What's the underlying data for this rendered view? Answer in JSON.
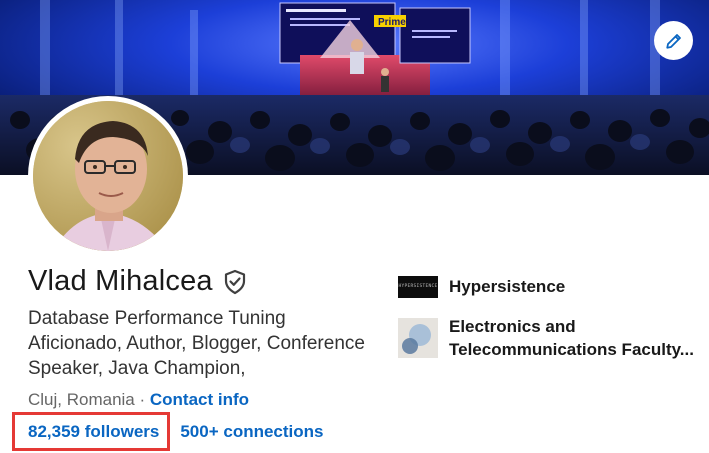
{
  "profile": {
    "name": "Vlad Mihalcea",
    "headline": "Database Performance Tuning Aficionado, Author, Blogger, Conference Speaker, Java Champion,",
    "location": "Cluj, Romania",
    "location_separator": " · ",
    "contact_info_label": "Contact info",
    "followers_label": "82,359 followers",
    "connections_label": "500+ connections"
  },
  "cover": {
    "slide_title": "Prime",
    "edit_icon": "pencil-icon"
  },
  "organizations": [
    {
      "name": "Hypersistence",
      "logo_text": "HYPERSISTENCE"
    },
    {
      "name_line1": "Electronics and",
      "name_line2": "Telecommunications Faculty..."
    }
  ],
  "colors": {
    "link": "#0a66c2",
    "highlight_border": "#e53935",
    "text": "#191919"
  }
}
